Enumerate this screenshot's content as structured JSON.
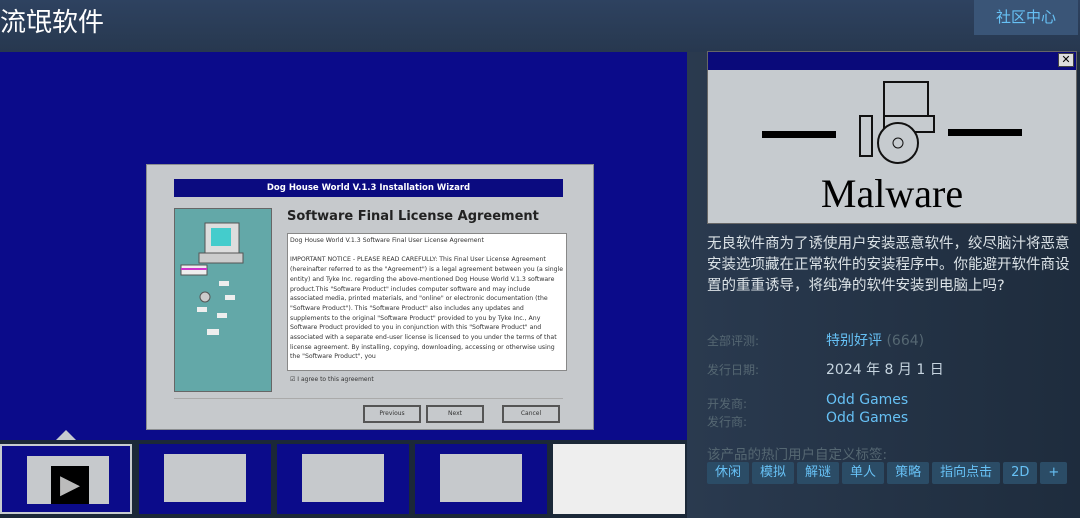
{
  "header": {
    "title": "流氓软件",
    "community_button": "社区中心"
  },
  "media": {
    "wizard_title": "Dog House World V.1.3 Installation Wizard",
    "heading": "Software Final License Agreement",
    "license_title": "Dog House World V.1.3 Software Final User License Agreement",
    "license_body": "IMPORTANT NOTICE - PLEASE READ CAREFULLY: This Final User License Agreement (hereinafter referred to as the \"Agreement\") is a legal agreement between you (a single entity) and Tyke Inc. regarding the above-mentioned Dog House World V.1.3 software product.This \"Software Product\" includes computer software and may include associated media, printed materials, and \"online\" or electronic documentation (the \"Software Product\"). This \"Software Product\" also includes any updates and supplements to the original \"Software Product\" provided to you by Tyke Inc., Any Software Product provided to you in conjunction with this \"Software Product\" and associated with a separate end-user license is licensed to you under the terms of that license agreement. By installing, copying, downloading, accessing or otherwise using the \"Software Product\", you",
    "agree_label": "I agree to this agreement",
    "buttons": {
      "previous": "Previous",
      "next": "Next",
      "cancel": "Cancel"
    }
  },
  "capsule": {
    "logo_text": "Malware"
  },
  "description": "无良软件商为了诱使用户安装恶意软件，绞尽脑汁将恶意安装选项藏在正常软件的安装程序中。你能避开软件商设置的重重诱导，将纯净的软件安装到电脑上吗?",
  "info": {
    "reviews_label": "全部评测:",
    "reviews_value": "特别好评",
    "reviews_count": "(664)",
    "release_label": "发行日期:",
    "release_value": "2024 年 8 月 1 日",
    "developer_label": "开发商:",
    "developer_value": "Odd Games",
    "publisher_label": "发行商:",
    "publisher_value": "Odd Games"
  },
  "tags_heading": "该产品的热门用户自定义标签:",
  "tags": [
    "休闲",
    "模拟",
    "解谜",
    "单人",
    "策略",
    "指向点击",
    "2D",
    "+"
  ]
}
